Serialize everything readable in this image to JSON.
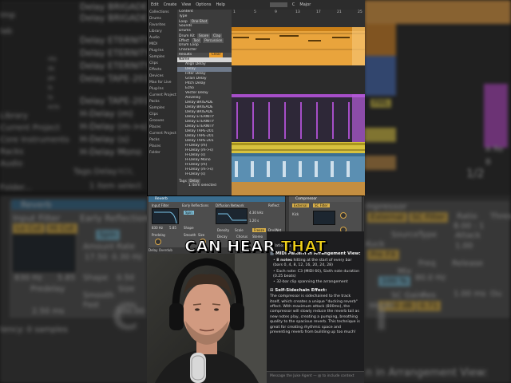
{
  "background_left": {
    "categories": [
      "Library",
      "Current Project",
      "Core Instruments",
      "Racks",
      "Audio",
      "Folder..."
    ],
    "partial_words": [
      "Imp",
      "lab",
      "nts",
      "ds",
      "pe",
      "ls",
      "ts",
      "ects"
    ],
    "devices": [
      "Delay BRIGADE",
      "Delay BRIGADE",
      "Delay ETERNITY",
      "Delay ETERNITY",
      "Delay ETERNITY",
      "Delay TAPE-201",
      "Delay TAPE-201",
      "H-Delay (m)",
      "H-Delay (m->s)",
      "H-Delay (s)",
      "H-Delay Mono"
    ],
    "tags_label": "Tags:",
    "tag_delay": "Delay",
    "tag_kol": "KOL",
    "item_count": "1 item select",
    "reverb_title": "Reverb",
    "input_filter": "Input Filter",
    "lo_cut": "Lo Cut",
    "hi_cut": "Hi Cut",
    "early_reflections": "Early Reflections",
    "spin": "Spin",
    "amount": "Amount",
    "amount_val": "17.50",
    "rate": "Rate",
    "rate_val": "0.30 Hz",
    "freq1": "830 Hz",
    "freq2": "5.85",
    "shape": "Shape",
    "shape_val": "0.50",
    "predelay": "Predelay",
    "predelay_val": "2.50 ms",
    "smooth": "Smooth",
    "smooth_val": "Fast",
    "size": "Size",
    "size_val": "100.00",
    "latency": "tency: 0 samples"
  },
  "background_right": {
    "page_nums": "1/2",
    "pml": "PML",
    "a_re": "A Re",
    "b_return": "B",
    "compressor": "mpressor",
    "external": "External",
    "sc_filter": "SC Filter",
    "ratio": "Ratio",
    "ratio_val": "8.00 : 1",
    "attack": "Attack",
    "attack_val": "1.00",
    "thresh": "Thres",
    "source": "Source",
    "source_val": "Kuck",
    "type": "Type",
    "pre_fx": "Pre FX",
    "freq": "Freq",
    "freq_val": "80.0 Hz",
    "release": "Release",
    "release_val": "1.00 ms",
    "mix": "Mix",
    "mix_val": "100 %",
    "sc_gain": "SC Gain",
    "sc_gain_val": "0.00 dB",
    "res": "Res",
    "res_val": "0.71",
    "out": "Ou",
    "arr_view": "n in Arrangement View:"
  },
  "window": {
    "topbar": [
      "Edit",
      "Create",
      "View",
      "Options",
      "Help"
    ],
    "key": "C",
    "scale": "Major",
    "categories": [
      "Collections",
      "Drums",
      "Favorites",
      "Library",
      "Audio",
      "MIDI",
      "Plug-Ins",
      "Samples",
      "Clips",
      "Effects",
      "Devices",
      "Max for Live",
      "Plug-Ins",
      "Current Project",
      "Packs",
      "Samples",
      "Clips",
      "Grooves",
      "Places",
      "Current Project",
      "Packs",
      "Places",
      "Folder"
    ],
    "filters": [
      [
        "Content",
        "",
        "",
        ""
      ],
      [
        "Type",
        "",
        "",
        ""
      ],
      [
        "Loop",
        "One-Shot",
        "",
        ""
      ],
      [
        "Sounds",
        "",
        "",
        ""
      ],
      [
        "Drums",
        "",
        "",
        ""
      ],
      [
        "Drum Kit",
        "Snare",
        "Clap",
        ""
      ],
      [
        "Effect",
        "Tool",
        "Percussion",
        ""
      ],
      [
        "Drum Loop",
        "",
        "",
        ""
      ],
      [
        "Character",
        "",
        "",
        ""
      ]
    ],
    "results_label": "Results",
    "clear": "Clear",
    "name_header": "Name",
    "files": [
      "Align Delay",
      "Delay",
      "Filter Delay",
      "Grain Delay",
      "Pitch Delay",
      "Echo",
      "Vector Delay",
      "AUDelay",
      "Delay BRIGADE",
      "Delay BRIGADE",
      "Delay BRIGADE",
      "Delay ETERNITY",
      "Delay ETERNITY",
      "Delay ETERNITY",
      "Delay TAPE-201",
      "Delay TAPE-201",
      "Delay TAPE-201",
      "H-Delay (m)",
      "H-Delay (m->s)",
      "H-Delay (s)",
      "H-Delay Mono",
      "H-Delay (m)",
      "H-Delay (m->s)",
      "H-Delay (s)"
    ],
    "tags_label": "Tags",
    "tag_delay": "Delay",
    "items_selected": "1 item selected",
    "ruler": [
      "1",
      "5",
      "9",
      "13",
      "17",
      "21",
      "25"
    ]
  },
  "rack": {
    "reverb": "Reverb",
    "input_filter": "Input Filter",
    "early_ref": "Early Reflections",
    "diffusion": "Diffusion Network",
    "reflect": "Reflect",
    "compressor": "Compressor",
    "ratio": "Ratio 8:1",
    "freq": "830 Hz",
    "val2": "5.85",
    "spin": "Spin",
    "shape": "Shape",
    "predelay": "Predelay",
    "smooth": "Smooth",
    "size": "Size",
    "stereo": "Stereo",
    "density": "Density",
    "scale": "Scale",
    "decay": "Decay",
    "chorus": "Chorus",
    "freeze": "Freeze",
    "dry_wet": "Dry/Wet",
    "val_time": "4.30 kHz",
    "val_size": "1.20 s",
    "external": "External",
    "sc_filter": "SC Filter",
    "kick": "Kick",
    "track_name": "Delay Overdub"
  },
  "chat": {
    "ratio_line": "Ratio: 8:1",
    "midi_title": "MIDI Pattern in Arrangement View:",
    "b1_bold": "8 notes",
    "b1_rest": "hitting at the start of every bar (bars 0, 4, 8, 12, 16, 20, 24, 28)",
    "b2": "Each note: C3 (MIDI 60), Sixth note duration (0.25 beats)",
    "b3": "32-bar clip spanning the arrangement",
    "sc_title": "Self-Sidechain Effect:",
    "para": "The compressor is sidechained to the track itself, which creates a unique \"ducking reverb\" effect. With maximum attack (800ms), the compressor will slowly reduce the reverb tail as new notes play, creating a pumping, breathing quality to the spacious reverb. This technique is great for creating rhythmic space and preventing reverb from building up too much!",
    "input_placeholder": "Message the Juke Agent — @ to include context"
  },
  "caption": {
    "w1": "CAN HEAR",
    "w2": "THAT",
    "big_left": "C",
    "big_right": "T"
  }
}
